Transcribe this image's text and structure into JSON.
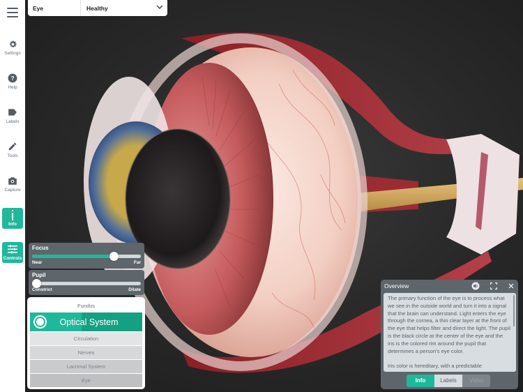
{
  "sidebar": {
    "menu_icon": "hamburger-menu-icon",
    "items": [
      {
        "label": "Settings",
        "icon": "gear-icon",
        "active": false
      },
      {
        "label": "Help",
        "icon": "question-circle-icon",
        "active": false
      },
      {
        "label": "Labels",
        "icon": "tag-icon",
        "active": false
      },
      {
        "label": "Tools",
        "icon": "pencil-icon",
        "active": false
      },
      {
        "label": "Capture",
        "icon": "camera-icon",
        "active": false
      },
      {
        "label": "Info",
        "icon": "info-icon",
        "active": true
      },
      {
        "label": "Controls",
        "icon": "sliders-icon",
        "active": true
      }
    ]
  },
  "topbar": {
    "model": "Eye",
    "condition": "Healthy",
    "dropdown_icon": "chevron-down-icon"
  },
  "controls": {
    "focus": {
      "title": "Focus",
      "min_label": "Near",
      "max_label": "Far",
      "value_percent": 75
    },
    "pupil": {
      "title": "Pupil",
      "min_label": "Constrict",
      "max_label": "Dilate",
      "value_percent": 0
    }
  },
  "layers": {
    "top": "Fundus",
    "active": "Optical System",
    "items": [
      "Circulation",
      "Nerves",
      "Lacrimal System",
      "Eye"
    ]
  },
  "overview": {
    "title": "Overview",
    "icons": [
      "speaker-icon",
      "fullscreen-icon",
      "close-icon"
    ],
    "paragraphs": [
      "The primary function of the eye is to process what we see in the outside world and turn it into a signal that the brain can understand. Light enters the eye through the cornea, a thin clear layer at the front of the eye that helps filter and direct the light. The pupil is the black circle at the center of the eye and the iris is the colored rim around the pupil that determines a person's eye color.",
      "Iris color is hereditary, with a predictable"
    ],
    "tabs": [
      {
        "label": "Info",
        "state": "active"
      },
      {
        "label": "Labels",
        "state": "normal"
      },
      {
        "label": "Video",
        "state": "disabled"
      }
    ]
  },
  "colors": {
    "accent": "#1fb89a",
    "accent_dark": "#16a083",
    "panel": "#5e666c",
    "sidebar_bg": "#ffffff",
    "background": "#2a2a2a"
  }
}
